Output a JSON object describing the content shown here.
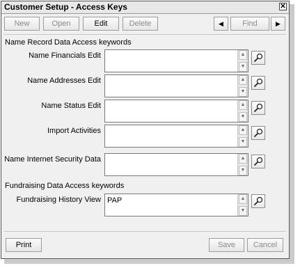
{
  "window": {
    "title": "Customer Setup - Access Keys",
    "close_glyph": "✕"
  },
  "toolbar": {
    "new_label": "New",
    "open_label": "Open",
    "edit_label": "Edit",
    "delete_label": "Delete",
    "prev_glyph": "◀",
    "find_label": "Find",
    "next_glyph": "▶"
  },
  "sections": {
    "name_record": "Name Record Data Access keywords",
    "fundraising": "Fundraising Data Access keywords"
  },
  "fields": [
    {
      "label": "Name Financials Edit",
      "value": ""
    },
    {
      "label": "Name Addresses Edit",
      "value": ""
    },
    {
      "label": "Name Status Edit",
      "value": ""
    },
    {
      "label": "Import Activities",
      "value": ""
    },
    {
      "label": "Name Internet Security Data",
      "value": ""
    },
    {
      "label": "Fundraising History View",
      "value": "PAP"
    }
  ],
  "footer": {
    "print_label": "Print",
    "save_label": "Save",
    "cancel_label": "Cancel"
  },
  "icons": {
    "lookup": "magnifier-icon",
    "scroll_up": "▲",
    "scroll_down": "▼"
  }
}
